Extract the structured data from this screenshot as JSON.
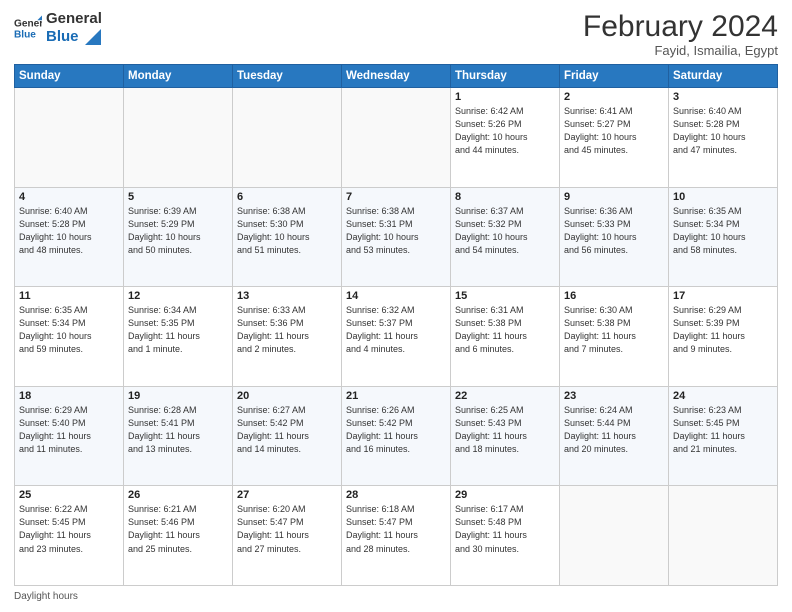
{
  "header": {
    "logo_line1": "General",
    "logo_line2": "Blue",
    "main_title": "February 2024",
    "subtitle": "Fayid, Ismailia, Egypt"
  },
  "weekdays": [
    "Sunday",
    "Monday",
    "Tuesday",
    "Wednesday",
    "Thursday",
    "Friday",
    "Saturday"
  ],
  "weeks": [
    [
      {
        "day": "",
        "info": ""
      },
      {
        "day": "",
        "info": ""
      },
      {
        "day": "",
        "info": ""
      },
      {
        "day": "",
        "info": ""
      },
      {
        "day": "1",
        "info": "Sunrise: 6:42 AM\nSunset: 5:26 PM\nDaylight: 10 hours\nand 44 minutes."
      },
      {
        "day": "2",
        "info": "Sunrise: 6:41 AM\nSunset: 5:27 PM\nDaylight: 10 hours\nand 45 minutes."
      },
      {
        "day": "3",
        "info": "Sunrise: 6:40 AM\nSunset: 5:28 PM\nDaylight: 10 hours\nand 47 minutes."
      }
    ],
    [
      {
        "day": "4",
        "info": "Sunrise: 6:40 AM\nSunset: 5:28 PM\nDaylight: 10 hours\nand 48 minutes."
      },
      {
        "day": "5",
        "info": "Sunrise: 6:39 AM\nSunset: 5:29 PM\nDaylight: 10 hours\nand 50 minutes."
      },
      {
        "day": "6",
        "info": "Sunrise: 6:38 AM\nSunset: 5:30 PM\nDaylight: 10 hours\nand 51 minutes."
      },
      {
        "day": "7",
        "info": "Sunrise: 6:38 AM\nSunset: 5:31 PM\nDaylight: 10 hours\nand 53 minutes."
      },
      {
        "day": "8",
        "info": "Sunrise: 6:37 AM\nSunset: 5:32 PM\nDaylight: 10 hours\nand 54 minutes."
      },
      {
        "day": "9",
        "info": "Sunrise: 6:36 AM\nSunset: 5:33 PM\nDaylight: 10 hours\nand 56 minutes."
      },
      {
        "day": "10",
        "info": "Sunrise: 6:35 AM\nSunset: 5:34 PM\nDaylight: 10 hours\nand 58 minutes."
      }
    ],
    [
      {
        "day": "11",
        "info": "Sunrise: 6:35 AM\nSunset: 5:34 PM\nDaylight: 10 hours\nand 59 minutes."
      },
      {
        "day": "12",
        "info": "Sunrise: 6:34 AM\nSunset: 5:35 PM\nDaylight: 11 hours\nand 1 minute."
      },
      {
        "day": "13",
        "info": "Sunrise: 6:33 AM\nSunset: 5:36 PM\nDaylight: 11 hours\nand 2 minutes."
      },
      {
        "day": "14",
        "info": "Sunrise: 6:32 AM\nSunset: 5:37 PM\nDaylight: 11 hours\nand 4 minutes."
      },
      {
        "day": "15",
        "info": "Sunrise: 6:31 AM\nSunset: 5:38 PM\nDaylight: 11 hours\nand 6 minutes."
      },
      {
        "day": "16",
        "info": "Sunrise: 6:30 AM\nSunset: 5:38 PM\nDaylight: 11 hours\nand 7 minutes."
      },
      {
        "day": "17",
        "info": "Sunrise: 6:29 AM\nSunset: 5:39 PM\nDaylight: 11 hours\nand 9 minutes."
      }
    ],
    [
      {
        "day": "18",
        "info": "Sunrise: 6:29 AM\nSunset: 5:40 PM\nDaylight: 11 hours\nand 11 minutes."
      },
      {
        "day": "19",
        "info": "Sunrise: 6:28 AM\nSunset: 5:41 PM\nDaylight: 11 hours\nand 13 minutes."
      },
      {
        "day": "20",
        "info": "Sunrise: 6:27 AM\nSunset: 5:42 PM\nDaylight: 11 hours\nand 14 minutes."
      },
      {
        "day": "21",
        "info": "Sunrise: 6:26 AM\nSunset: 5:42 PM\nDaylight: 11 hours\nand 16 minutes."
      },
      {
        "day": "22",
        "info": "Sunrise: 6:25 AM\nSunset: 5:43 PM\nDaylight: 11 hours\nand 18 minutes."
      },
      {
        "day": "23",
        "info": "Sunrise: 6:24 AM\nSunset: 5:44 PM\nDaylight: 11 hours\nand 20 minutes."
      },
      {
        "day": "24",
        "info": "Sunrise: 6:23 AM\nSunset: 5:45 PM\nDaylight: 11 hours\nand 21 minutes."
      }
    ],
    [
      {
        "day": "25",
        "info": "Sunrise: 6:22 AM\nSunset: 5:45 PM\nDaylight: 11 hours\nand 23 minutes."
      },
      {
        "day": "26",
        "info": "Sunrise: 6:21 AM\nSunset: 5:46 PM\nDaylight: 11 hours\nand 25 minutes."
      },
      {
        "day": "27",
        "info": "Sunrise: 6:20 AM\nSunset: 5:47 PM\nDaylight: 11 hours\nand 27 minutes."
      },
      {
        "day": "28",
        "info": "Sunrise: 6:18 AM\nSunset: 5:47 PM\nDaylight: 11 hours\nand 28 minutes."
      },
      {
        "day": "29",
        "info": "Sunrise: 6:17 AM\nSunset: 5:48 PM\nDaylight: 11 hours\nand 30 minutes."
      },
      {
        "day": "",
        "info": ""
      },
      {
        "day": "",
        "info": ""
      }
    ]
  ],
  "footer": {
    "label": "Daylight hours"
  }
}
